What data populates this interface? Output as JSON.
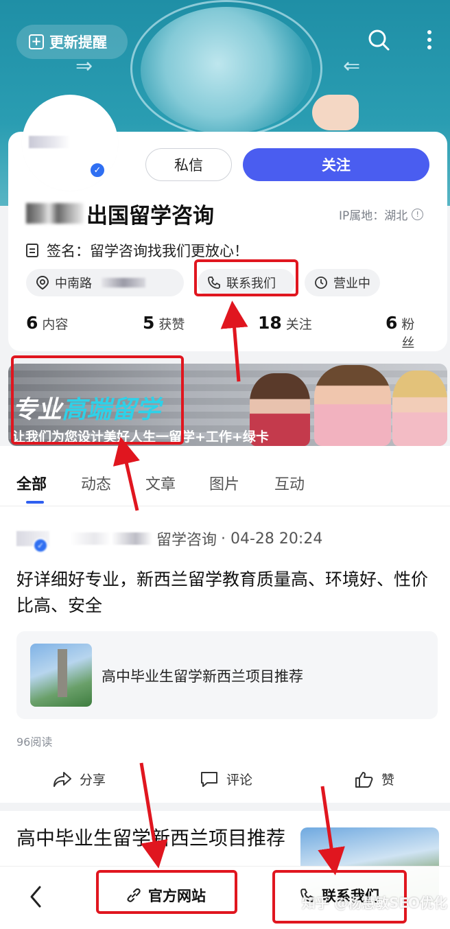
{
  "header": {
    "update_label": "更新提醒"
  },
  "profile": {
    "message_label": "私信",
    "follow_label": "关注",
    "name_suffix": "出国留学咨询",
    "ip_location": "IP属地：湖北",
    "signature": "签名：留学咨询找我们更放心！",
    "address": "中南路",
    "contact_label": "联系我们",
    "business_status": "营业中",
    "stats": {
      "content_count": "6",
      "content_label": "内容",
      "likes_count": "5",
      "likes_label": "获赞",
      "following_count": "18",
      "following_label": "关注",
      "fans_count": "6",
      "fans_label": "粉丝"
    }
  },
  "promo": {
    "title_plain": "专业",
    "title_highlight": "高端留学",
    "subtitle": "让我们为您设计美好人生一留学+工作+绿卡"
  },
  "tabs": [
    "全部",
    "动态",
    "文章",
    "图片",
    "互动"
  ],
  "post": {
    "author_suffix": "留学咨询",
    "timestamp": "· 04-28 20:24",
    "text": "好详细好专业，新西兰留学教育质量高、环境好、性价比高、安全",
    "link_title": "高中毕业生留学新西兰项目推荐",
    "read_count": "96阅读",
    "share_label": "分享",
    "comment_label": "评论",
    "like_label": "赞"
  },
  "post2": {
    "title": "高中毕业生留学新西兰项目推荐"
  },
  "bottom_bar": {
    "website_label": "官方网站",
    "contact_label": "联系我们"
  },
  "watermark": "知乎 @杨慧敏SEO优化"
}
